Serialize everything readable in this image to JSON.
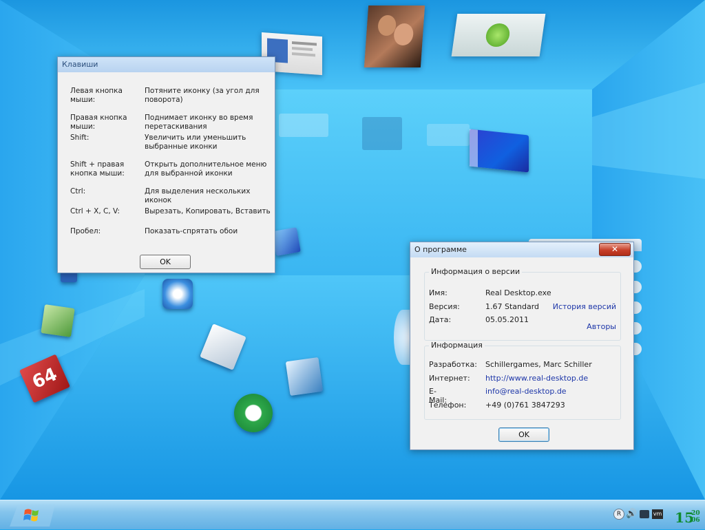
{
  "keys_dialog": {
    "title": "Клавиши",
    "rows": [
      {
        "key": "Левая кнопка мыши:",
        "action": "Потяните иконку (за угол для поворота)"
      },
      {
        "key": "Правая кнопка мыши:",
        "action": "Поднимает иконку во время перетаскивания"
      },
      {
        "key": "Shift:",
        "action": "Увеличить или уменьшить выбранные иконки"
      },
      {
        "key": "Shift + правая кнопка мыши:",
        "action": "Открыть дополнительное меню для выбранной иконки"
      },
      {
        "key": "Ctrl:",
        "action": "Для выделения нескольких иконок"
      },
      {
        "key": "Ctrl + X, C, V:",
        "action": "Вырезать, Копировать, Вставить"
      },
      {
        "key": "Пробел:",
        "action": "Показать-спрятать обои"
      }
    ],
    "ok_label": "OK"
  },
  "about_dialog": {
    "title": "О программе",
    "close_glyph": "✕",
    "version_group": {
      "legend": "Информация о версии",
      "name_label": "Имя:",
      "name_value": "Real Desktop.exe",
      "version_label": "Версия:",
      "version_value": "1.67 Standard",
      "version_history_link": "История версий",
      "date_label": "Дата:",
      "date_value": "05.05.2011",
      "authors_link": "Авторы"
    },
    "info_group": {
      "legend": "Информация",
      "dev_label": "Разработка:",
      "dev_value": "Schillergames, Marc Schiller",
      "web_label": "Интернет:",
      "web_value": "http://www.real-desktop.de",
      "email_label": "E-Mail:",
      "email_value": "info@real-desktop.de",
      "phone_label": "Телефон:",
      "phone_value": "+49 (0)761 3847293"
    },
    "ok_label": "OK"
  },
  "taskbar": {
    "clock_hour": "15",
    "clock_min": "20",
    "clock_sub": "06"
  },
  "colors": {
    "desktop": "#1fa8ee",
    "clock": "#0e8a2e",
    "link": "#1d36a8"
  }
}
